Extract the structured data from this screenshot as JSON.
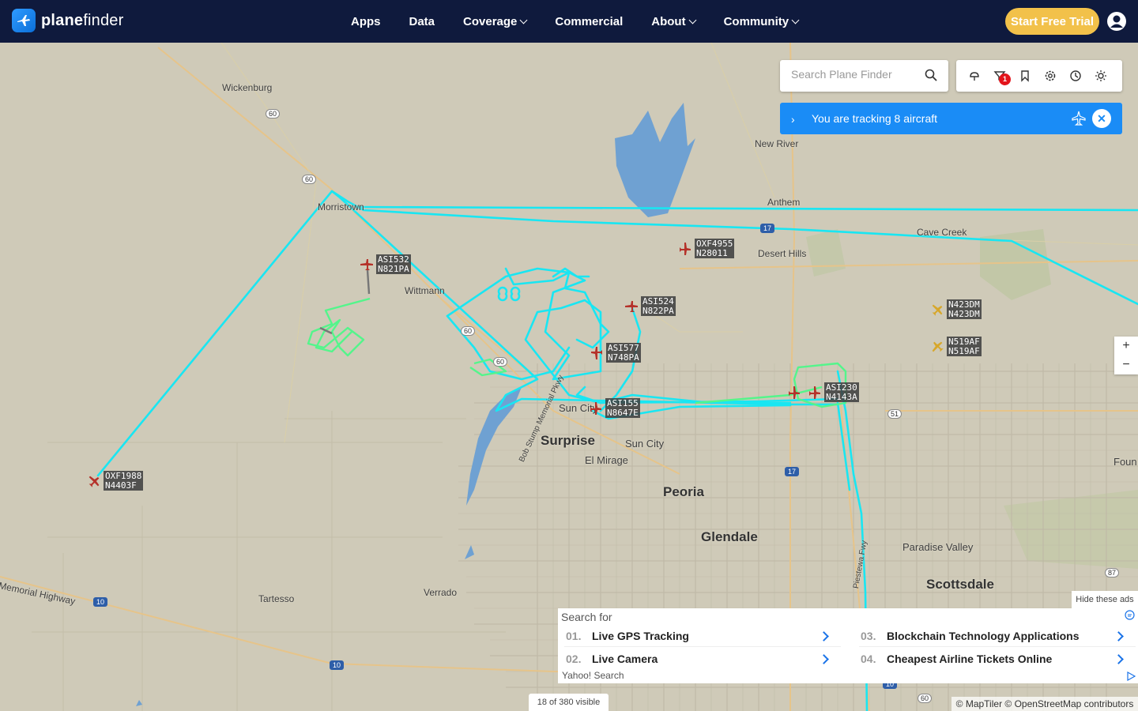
{
  "brand": {
    "name_a": "plane",
    "name_b": "finder"
  },
  "nav": {
    "items": [
      {
        "label": "Apps",
        "dropdown": false
      },
      {
        "label": "Data",
        "dropdown": false
      },
      {
        "label": "Coverage",
        "dropdown": true
      },
      {
        "label": "Commercial",
        "dropdown": false
      },
      {
        "label": "About",
        "dropdown": true
      },
      {
        "label": "Community",
        "dropdown": true
      }
    ],
    "trial_label": "Start Free Trial"
  },
  "search": {
    "placeholder": "Search Plane Finder"
  },
  "toolbar": {
    "buttons": [
      "weather-icon",
      "filter-icon",
      "bookmark-icon",
      "settings-icon",
      "history-icon",
      "sun-icon"
    ],
    "filter_badge": "1"
  },
  "tracking": {
    "arrow": "›",
    "text": "You are tracking 8 aircraft",
    "close": "✕"
  },
  "zoom": {
    "in": "+",
    "out": "−"
  },
  "places": {
    "wickenburg": "Wickenburg",
    "morristown": "Morristown",
    "wittmann": "Wittmann",
    "new_river": "New River",
    "anthem": "Anthem",
    "desert_hills": "Desert Hills",
    "cave_creek": "Cave Creek",
    "surprise": "Surprise",
    "sun_city": "Sun City",
    "sun_city_w": "Sun City",
    "el_mirage": "El Mirage",
    "peoria": "Peoria",
    "glendale": "Glendale",
    "paradise_valley": "Paradise Valley",
    "scottsdale": "Scottsdale",
    "tartesso": "Tartesso",
    "verrado": "Verrado",
    "memorial_highway": "Memorial Highway",
    "bob_stump": "Bob Stump Memorial Pkwy",
    "piestewa": "Piestewa Fwy",
    "foun": "Foun"
  },
  "shields": [
    "60",
    "60",
    "60",
    "60",
    "17",
    "51",
    "87",
    "10",
    "10",
    "10",
    "17",
    "60"
  ],
  "aircraft": [
    {
      "callsign": "ASI532",
      "reg": "N821PA",
      "color": "#b5322a"
    },
    {
      "callsign": "OXF4955",
      "reg": "N28011",
      "color": "#b5322a"
    },
    {
      "callsign": "ASI524",
      "reg": "N822PA",
      "color": "#b5322a"
    },
    {
      "callsign": "ASI577",
      "reg": "N748PA",
      "color": "#b5322a"
    },
    {
      "callsign": "ASI155",
      "reg": "N8647E",
      "color": "#b5322a"
    },
    {
      "callsign": "ASI230",
      "reg": "N4143A",
      "color": "#b5322a"
    },
    {
      "callsign": "N423DM",
      "reg": "N423DM",
      "color": "#d7a72a"
    },
    {
      "callsign": "N519AF",
      "reg": "N519AF",
      "color": "#d7a72a"
    },
    {
      "callsign": "OXF1988",
      "reg": "N4403F",
      "color": "#b5322a"
    }
  ],
  "ads": {
    "hide_label": "Hide these ads",
    "header": "Search for",
    "items": [
      {
        "num": "01.",
        "label": "Live GPS Tracking"
      },
      {
        "num": "02.",
        "label": "Live Camera"
      },
      {
        "num": "03.",
        "label": "Blockchain Technology Applications"
      },
      {
        "num": "04.",
        "label": "Cheapest Airline Tickets Online"
      }
    ],
    "footer": "Yahoo! Search"
  },
  "status": {
    "visible": "18 of 380 visible",
    "attribution": "© MapTiler © OpenStreetMap contributors"
  },
  "colors": {
    "nav_bg": "#0f1a3d",
    "accent": "#1a8cf6",
    "trial": "#f2c14a",
    "track_cyan": "#19e6f2",
    "track_green": "#54f58b",
    "water": "#6fa1d2"
  }
}
